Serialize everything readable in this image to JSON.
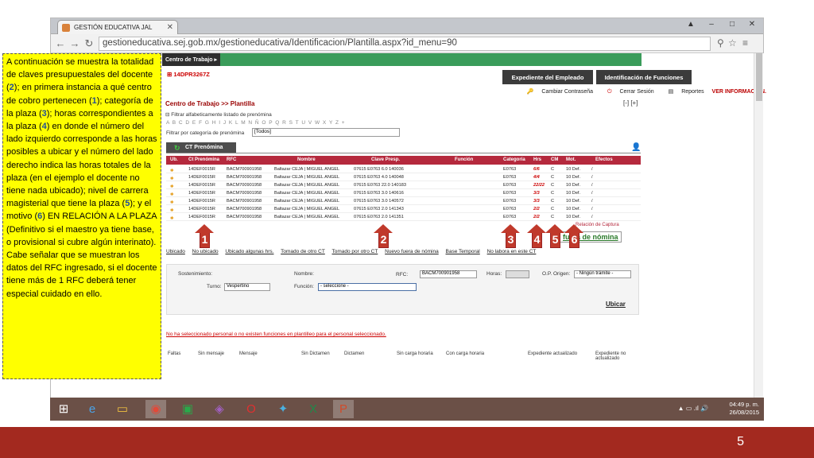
{
  "browser": {
    "tab_title": "GESTIÓN EDUCATIVA JAL",
    "url": "gestioneducativa.sej.gob.mx/gestioneducativa/Identificacion/Plantilla.aspx?id_menu=90"
  },
  "app": {
    "ct_button": "Centro de Trabajo",
    "ct_code": "14DPR3267Z",
    "btn_expediente": "Expediente del Empleado",
    "btn_identificacion": "Identificación de Funciones",
    "link_password": "Cambiar Contraseña",
    "link_logout": "Cerrar Sesión",
    "link_reports": "Reportes",
    "link_info": "VER INFORMACIÓN.",
    "breadcrumb": "Centro de Trabajo >> Plantilla",
    "collapse": "[-] [+]",
    "filter_label": "Filtrar alfabeticamente listado de prenómina",
    "letters": "A B C D E F G H I J K L M N Ñ O P Q R S T U V W X Y Z +",
    "category_label": "Filtrar por categoría de prenómina",
    "category_value": "[Todos]",
    "ct_tab": "CT Prenómina"
  },
  "table": {
    "headers": [
      "Ub.",
      "Ct Prenómina",
      "RFC",
      "Nombre",
      "Clave Presp.",
      "Función",
      "Categoría",
      "Hrs",
      "CM",
      "Mot.",
      "Efectos"
    ],
    "rows": [
      {
        "ct": "14DEF0015R",
        "rfc": "BACM700901958",
        "nombre": "Baltazar CEJA | MIGUEL ANGEL",
        "clave": "07615 E0763 6.0 140036",
        "cat": "E0763",
        "hrs": "6/6",
        "cm": "C",
        "mot": "10 Def.",
        "ef": "/"
      },
      {
        "ct": "14DEF0015R",
        "rfc": "BACM700901958",
        "nombre": "Baltazar CEJA | MIGUEL ANGEL",
        "clave": "07615 E0763 4.0 140048",
        "cat": "E0763",
        "hrs": "4/4",
        "cm": "C",
        "mot": "10 Def.",
        "ef": "/"
      },
      {
        "ct": "14DEF0015R",
        "rfc": "BACM700901958",
        "nombre": "Baltazar CEJA | MIGUEL ANGEL",
        "clave": "07615 E0763 22.0 140183",
        "cat": "E0763",
        "hrs": "22/22",
        "cm": "C",
        "mot": "10 Def.",
        "ef": "/"
      },
      {
        "ct": "14DEF0015R",
        "rfc": "BACM700901958",
        "nombre": "Baltazar CEJA | MIGUEL ANGEL",
        "clave": "07615 E0763 3.0 140616",
        "cat": "E0763",
        "hrs": "3/3",
        "cm": "C",
        "mot": "10 Def.",
        "ef": "/"
      },
      {
        "ct": "14DEF0015R",
        "rfc": "BACM700901958",
        "nombre": "Baltazar CEJA | MIGUEL ANGEL",
        "clave": "07615 E0763 3.0 140572",
        "cat": "E0763",
        "hrs": "3/3",
        "cm": "C",
        "mot": "10 Def.",
        "ef": "/"
      },
      {
        "ct": "14DEF0015R",
        "rfc": "BACM700901958",
        "nombre": "Baltazar CEJA | MIGUEL ANGEL",
        "clave": "07615 E0763 2.0 141343",
        "cat": "E0763",
        "hrs": "2/2",
        "cm": "C",
        "mot": "10 Def.",
        "ef": "/"
      },
      {
        "ct": "14DEF0015R",
        "rfc": "BACM700901958",
        "nombre": "Baltazar CEJA | MIGUEL ANGEL",
        "clave": "07615 E0763 2.0 141351",
        "cat": "E0763",
        "hrs": "2/2",
        "cm": "C",
        "mot": "10 Def.",
        "ef": "/"
      }
    ],
    "relacion": "Relación de Captura",
    "fuera_nomina": "fuera de nómina"
  },
  "legend": [
    "Ubicado",
    "No ubicado",
    "Ubicado algunas hrs.",
    "Tomado de otro CT",
    "Tomado por otro CT",
    "Nuevo fuera de nómina",
    "Base Temporal",
    "No labora en este CT"
  ],
  "form": {
    "sostenimiento_label": "Sostenimiento:",
    "nombre_label": "Nombre:",
    "rfc_label": "RFC:",
    "rfc_value": "BACM700901958",
    "horas_label": "Horas:",
    "origen_label": "O.P. Origen:",
    "origen_value": "- Ningún trámite -",
    "turno_label": "Turno:",
    "turno_value": "Vespertino",
    "funcion_label": "Función:",
    "funcion_value": "- seleccione -",
    "ubicar": "Ubicar"
  },
  "messages": {
    "no_selection": "No ha seleccionado personal o no existen funciones en plantilleo para el personal seleccionado."
  },
  "foot_legend": [
    "Faltas",
    "Sin mensaje",
    "Mensaje",
    "Sin Dictamen",
    "Dictamen",
    "Sin carga horaria",
    "Con carga horaria",
    "Expediente actualizado",
    "Expediente no actualizado"
  ],
  "callout": {
    "p1": "A continuación se muestra la totalidad de claves presupuestales del docente (",
    "n2": "2",
    "p2": "); en primera instancia a qué centro de cobro pertenecen (",
    "n1": "1",
    "p3": "); categoría de la plaza (",
    "n3": "3",
    "p4": "); horas correspondientes a la plaza (",
    "n4": "4",
    "p5": ") en donde el número del lado izquierdo corresponde a las horas posibles a ubicar y el número del lado derecho indica las horas totales de la plaza (en el ejemplo el docente no tiene nada ubicado); nivel de carrera magisterial que tiene la plaza (",
    "n5": "5",
    "p6": "); y el motivo (",
    "n6": "6",
    "p7": ") EN RELACIÓN A LA PLAZA (Definitivo si el maestro ya tiene base, o provisional si cubre algún interinato). Cabe señalar que se muestran los datos del RFC ingresado, si el docente tiene más de 1 RFC deberá tener especial cuidado en ello."
  },
  "arrows": [
    "1",
    "2",
    "3",
    "4",
    "5",
    "6"
  ],
  "clock": {
    "time": "04:49 p. m.",
    "date": "26/08/2015"
  },
  "slide_number": "5",
  "colors": {
    "green": "#3a9c5a",
    "table_header": "#b5293d",
    "callout": "#ffff00",
    "bottom_bar": "#a3291f"
  }
}
